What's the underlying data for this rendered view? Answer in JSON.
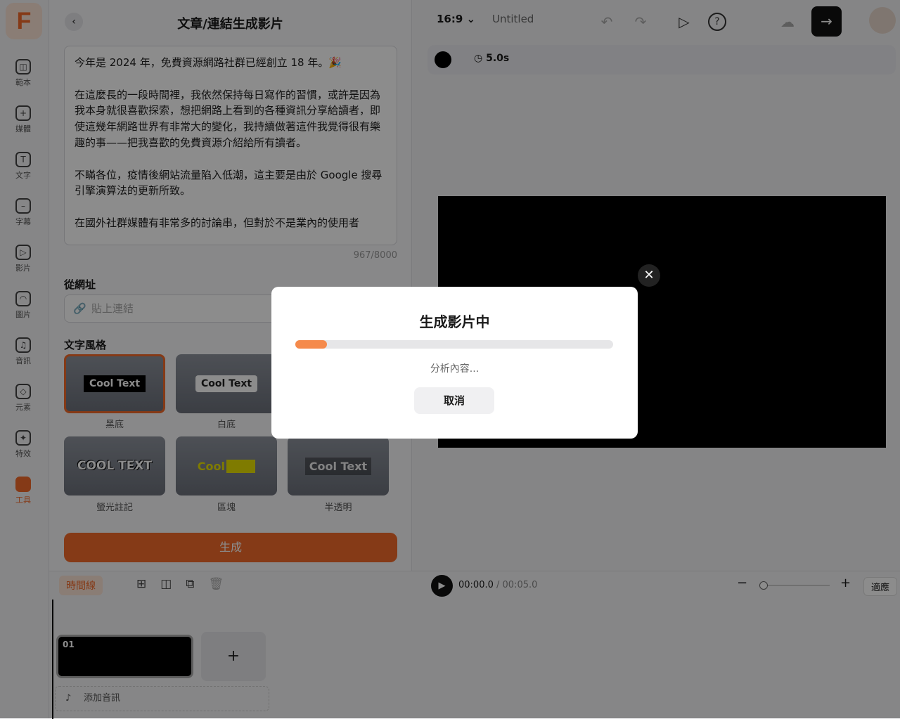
{
  "brand": {
    "logo": "F",
    "accent": "#f26b2a"
  },
  "sidebar": {
    "items": [
      {
        "label": "範本",
        "icon": "template-icon"
      },
      {
        "label": "媒體",
        "icon": "media-folder-icon"
      },
      {
        "label": "文字",
        "icon": "text-icon"
      },
      {
        "label": "字幕",
        "icon": "subtitle-icon"
      },
      {
        "label": "影片",
        "icon": "video-icon"
      },
      {
        "label": "圖片",
        "icon": "image-icon"
      },
      {
        "label": "音訊",
        "icon": "music-icon"
      },
      {
        "label": "元素",
        "icon": "elements-icon"
      },
      {
        "label": "特效",
        "icon": "effects-icon"
      },
      {
        "label": "工具",
        "icon": "toolbox-icon",
        "active": true
      }
    ]
  },
  "panel": {
    "title": "文章/連結生成影片",
    "text": "今年是 2024 年，免費資源網路社群已經創立 18 年。🎉\n\n在這麼長的一段時間裡，我依然保持每日寫作的習慣，或許是因為我本身就很喜歡探索，想把網路上看到的各種資訊分享給讀者，即使這幾年網路世界有非常大的變化，我持續做著這件我覺得很有樂趣的事——把我喜歡的免費資源介紹給所有讀者。\n\n不瞞各位，疫情後網站流量陷入低潮，這主要是由於 Google 搜尋引擎演算法的更新所致。\n\n在國外社群媒體有非常多的討論串，但對於不是業內的使用者",
    "char_count": "967/8000",
    "url_label": "從網址",
    "url_placeholder": "貼上連結",
    "style_label": "文字風格",
    "styles": [
      {
        "preview": "Cool Text",
        "name": "黑底"
      },
      {
        "preview": "Cool Text",
        "name": "白底"
      },
      {
        "preview": "COOL TEXT",
        "name": "螢光註記"
      },
      {
        "preview": "Cool Text",
        "name": "區塊"
      },
      {
        "preview": "Cool Text",
        "name": "半透明"
      }
    ],
    "generate": "生成"
  },
  "topbar": {
    "ratio": "16:9",
    "project_name": "Untitled"
  },
  "props": {
    "duration": "5.0s",
    "color": "#000000"
  },
  "timeline": {
    "tab": "時間線",
    "current": "00:00.0",
    "total": "/ 00:05.0",
    "fit": "適應",
    "clip_label": "01",
    "add_clip": "+",
    "add_audio": "添加音訊"
  },
  "modal": {
    "title": "生成影片中",
    "progress": 0.1,
    "status": "分析內容...",
    "cancel": "取消"
  }
}
